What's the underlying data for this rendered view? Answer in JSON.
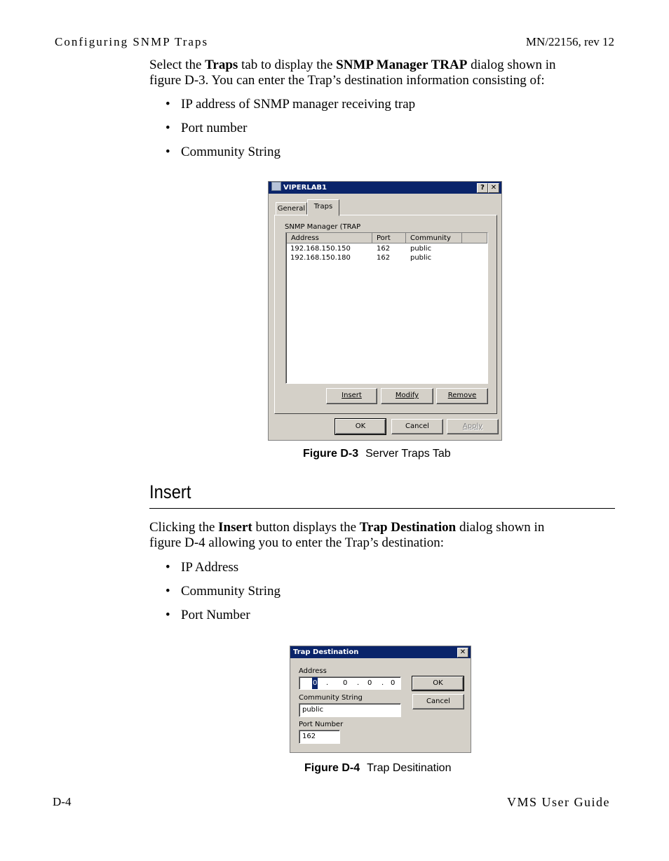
{
  "page": {
    "running_header_left": "Configuring SNMP Traps",
    "running_header_right": "MN/22156, rev 12",
    "footer_left": "D-4",
    "footer_right": "VMS User Guide"
  },
  "intro": {
    "p1_a": "Select the ",
    "p1_b": "Traps",
    "p1_c": " tab to display the ",
    "p1_d": "SNMP Manager TRAP",
    "p1_e": " dialog shown in",
    "p1_line2": "figure D-3. You can enter the Trap’s destination information consisting of:",
    "bullets": [
      "IP address of SNMP manager receiving trap",
      "Port number",
      "Community String"
    ]
  },
  "figure_d3": {
    "window_title": "VIPERLAB1",
    "help_button": "?",
    "close_button": "✕",
    "tabs": [
      {
        "label": "General",
        "active": false
      },
      {
        "label": "Traps",
        "active": true
      }
    ],
    "group_label": "SNMP Manager (TRAP",
    "columns": [
      "Address",
      "Port",
      "Community"
    ],
    "rows": [
      {
        "address": "192.168.150.150",
        "port": "162",
        "community": "public"
      },
      {
        "address": "192.168.150.180",
        "port": "162",
        "community": "public"
      }
    ],
    "buttons": {
      "insert": "Insert",
      "modify": "Modify",
      "remove": "Remove",
      "ok": "OK",
      "cancel": "Cancel",
      "apply": "Apply"
    },
    "caption_label": "Figure D-3",
    "caption_text": "Server Traps Tab"
  },
  "insert_section": {
    "title": "Insert",
    "p_a": "Clicking the ",
    "p_b": "Insert",
    "p_c": " button displays the ",
    "p_d": "Trap Destination",
    "p_e": " dialog shown in",
    "p_line2": "figure D-4 allowing you to enter the Trap’s destination:",
    "bullets": [
      "IP Address",
      "Community String",
      "Port Number"
    ]
  },
  "figure_d4": {
    "window_title": "Trap Destination",
    "close_button": "✕",
    "address_label": "Address",
    "address_octets": [
      "0",
      "0",
      "0",
      "0"
    ],
    "community_label": "Community String",
    "community_value": "public",
    "port_label": "Port Number",
    "port_value": "162",
    "ok": "OK",
    "cancel": "Cancel",
    "caption_label": "Figure D-4",
    "caption_text": "Trap Desitination"
  }
}
